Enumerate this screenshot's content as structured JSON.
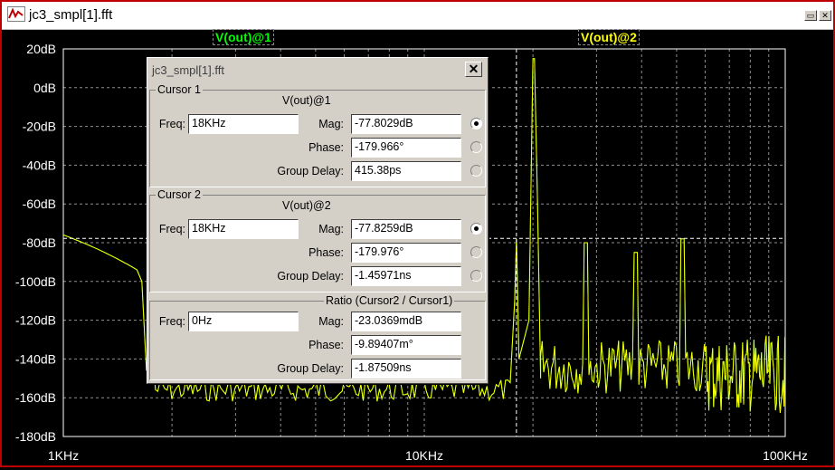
{
  "window": {
    "title": "jc3_smpl[1].fft"
  },
  "plot": {
    "trace_labels": [
      {
        "text": "V(out)@1",
        "color": "#00ff00"
      },
      {
        "text": "V(out)@2",
        "color": "#ffff00"
      }
    ],
    "y_ticks": [
      "20dB",
      "0dB",
      "-20dB",
      "-40dB",
      "-60dB",
      "-80dB",
      "-100dB",
      "-120dB",
      "-140dB",
      "-160dB",
      "-180dB"
    ],
    "x_ticks": [
      "1KHz",
      "10KHz",
      "100KHz"
    ],
    "colors": {
      "background": "#000000",
      "grid": "#909090",
      "trace1": "#00ff00",
      "trace2": "#ffff00",
      "axis_text": "#ffffff"
    }
  },
  "dialog": {
    "title": "jc3_smpl[1].fft",
    "close_glyph": "✕",
    "cursor1": {
      "group_label": "Cursor 1",
      "trace": "V(out)@1",
      "freq_label": "Freq:",
      "freq": "18KHz",
      "mag_label": "Mag:",
      "mag": "-77.8029dB",
      "phase_label": "Phase:",
      "phase": "-179.966°",
      "gd_label": "Group Delay:",
      "gd": "415.38ps"
    },
    "cursor2": {
      "group_label": "Cursor 2",
      "trace": "V(out)@2",
      "freq_label": "Freq:",
      "freq": "18KHz",
      "mag_label": "Mag:",
      "mag": "-77.8259dB",
      "phase_label": "Phase:",
      "phase": "-179.976°",
      "gd_label": "Group Delay:",
      "gd": "-1.45971ns"
    },
    "ratio": {
      "group_label": "Ratio (Cursor2 / Cursor1)",
      "freq_label": "Freq:",
      "freq": "0Hz",
      "mag_label": "Mag:",
      "mag": "-23.0369mdB",
      "phase_label": "Phase:",
      "phase": "-9.89407m°",
      "gd_label": "Group Delay:",
      "gd": "-1.87509ns"
    }
  }
}
